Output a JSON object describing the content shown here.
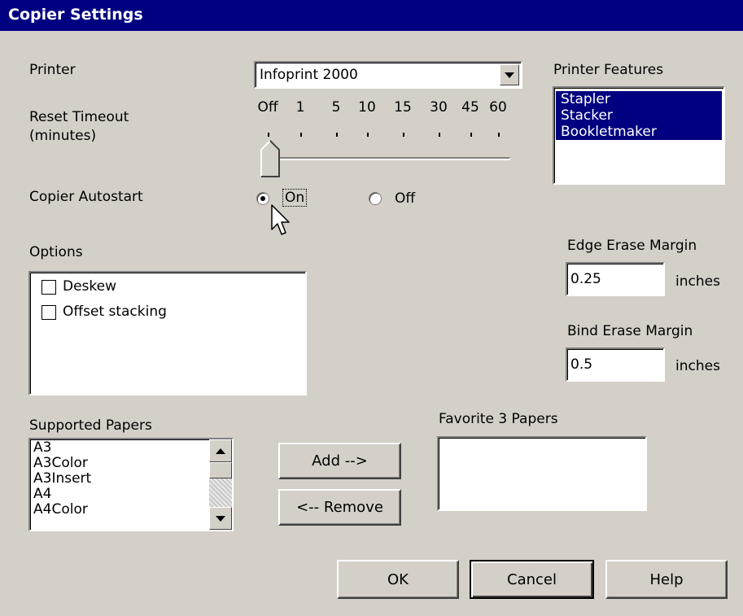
{
  "window": {
    "title": "Copier Settings"
  },
  "printer": {
    "label": "Printer",
    "selected": "Infoprint 2000"
  },
  "features": {
    "label": "Printer Features",
    "items": [
      "Stapler",
      "Stacker",
      "Bookletmaker"
    ]
  },
  "timeout": {
    "label_line1": "Reset Timeout",
    "label_line2": "(minutes)",
    "ticks": [
      "Off",
      "1",
      "5",
      "10",
      "15",
      "30",
      "45",
      "60"
    ],
    "selected_index": 0
  },
  "autostart": {
    "label": "Copier Autostart",
    "on_label": "On",
    "off_label": "Off",
    "selected": "On"
  },
  "options": {
    "label": "Options",
    "items": [
      {
        "label": "Deskew",
        "checked": false
      },
      {
        "label": "Offset stacking",
        "checked": false
      }
    ]
  },
  "edge_erase": {
    "label": "Edge Erase Margin",
    "value": "0.25",
    "unit": "inches"
  },
  "bind_erase": {
    "label": "Bind Erase Margin",
    "value": "0.5",
    "unit": "inches"
  },
  "supported": {
    "label": "Supported Papers",
    "items": [
      "A3",
      "A3Color",
      "A3Insert",
      "A4",
      "A4Color"
    ]
  },
  "favorites": {
    "label": "Favorite 3 Papers",
    "items": []
  },
  "buttons": {
    "add": "Add -->",
    "remove": "<-- Remove",
    "ok": "OK",
    "cancel": "Cancel",
    "help": "Help"
  }
}
